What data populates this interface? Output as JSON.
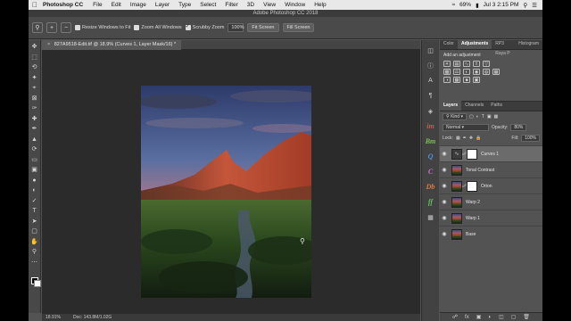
{
  "mac_menu": {
    "app_name": "Photoshop CC",
    "items": [
      "File",
      "Edit",
      "Image",
      "Layer",
      "Type",
      "Select",
      "Filter",
      "3D",
      "View",
      "Window",
      "Help"
    ],
    "battery": "69%",
    "clock": "Jul 3  2:15 PM"
  },
  "window": {
    "title": "Adobe Photoshop CC 2018"
  },
  "options": {
    "resize_windows": "Resize Windows to Fit",
    "zoom_all": "Zoom All Windows",
    "scrubby_zoom": "Scrubby Zoom",
    "zoom_value": "100%",
    "fit_screen": "Fit Screen",
    "fill_screen": "Fill Screen"
  },
  "document": {
    "tab_title": "827A9518-Edit.tif @ 18.9% (Curves 1, Layer Mask/16) *"
  },
  "status": {
    "zoom": "18.91%",
    "doc_size": "Doc: 143.8M/1.02G"
  },
  "top_panel": {
    "tabs": [
      "Color",
      "Adjustments",
      "RP3 Raya P",
      "Histogram"
    ],
    "active_tab": "Adjustments",
    "heading": "Add an adjustment"
  },
  "layers_panel": {
    "tabs": [
      "Layers",
      "Channels",
      "Paths"
    ],
    "active_tab": "Layers",
    "kind_label": "Kind",
    "blend_mode": "Normal",
    "opacity_label": "Opacity:",
    "opacity_value": "80%",
    "lock_label": "Lock:",
    "fill_label": "Fill:",
    "fill_value": "100%",
    "layers": [
      {
        "name": "Curves 1",
        "selected": true
      },
      {
        "name": "Tonal Contrast",
        "selected": false
      },
      {
        "name": "Orton",
        "selected": false
      },
      {
        "name": "Warp 2",
        "selected": false
      },
      {
        "name": "Warp 1",
        "selected": false
      },
      {
        "name": "Base",
        "selected": false
      }
    ]
  },
  "plugin_icons": [
    "im",
    "Bm",
    "Q",
    "C",
    "Db",
    "ff"
  ],
  "colors": {
    "accent": "#6b6b6b",
    "canvas": "#2b2b2b",
    "panel": "#535353"
  }
}
